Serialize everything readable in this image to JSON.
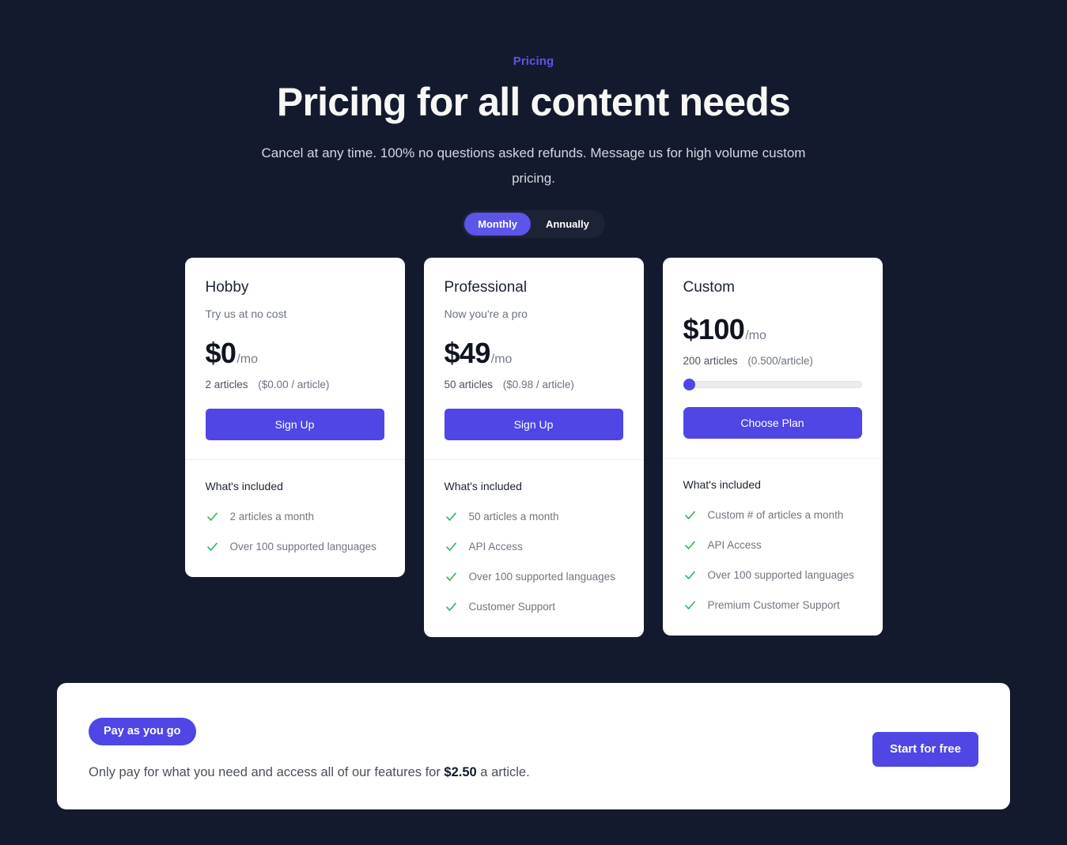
{
  "header": {
    "eyebrow": "Pricing",
    "headline": "Pricing for all content needs",
    "subhead": "Cancel at any time. 100% no questions asked refunds. Message us for high volume custom pricing."
  },
  "billing_toggle": {
    "monthly_label": "Monthly",
    "annually_label": "Annually",
    "selected": "Monthly"
  },
  "plans": [
    {
      "name": "Hobby",
      "tagline": "Try us at no cost",
      "price": "$0",
      "period": "/mo",
      "quota": "2 articles",
      "rate": "($0.00 / article)",
      "cta_label": "Sign Up",
      "included_title": "What's included",
      "features": [
        "2 articles a month",
        "Over 100 supported languages"
      ]
    },
    {
      "name": "Professional",
      "tagline": "Now you're a pro",
      "price": "$49",
      "period": "/mo",
      "quota": "50 articles",
      "rate": "($0.98 / article)",
      "cta_label": "Sign Up",
      "included_title": "What's included",
      "features": [
        "50 articles a month",
        "API Access",
        "Over 100 supported languages",
        "Customer Support"
      ]
    },
    {
      "name": "Custom",
      "tagline": "",
      "price": "$100",
      "period": "/mo",
      "quota": "200 articles",
      "rate": "(0.500/article)",
      "cta_label": "Choose Plan",
      "included_title": "What's included",
      "slider_value": 0,
      "features": [
        "Custom # of articles a month",
        "API Access",
        "Over 100 supported languages",
        "Premium Customer Support"
      ]
    }
  ],
  "banner": {
    "badge": "Pay as you go",
    "text_before": "Only pay for what you need and access all of our features for ",
    "price": "$2.50",
    "text_after": " a article.",
    "cta_label": "Start for free"
  },
  "colors": {
    "page_background": "#141a2e",
    "accent": "#4f46e5",
    "eyebrow": "#5b55ea",
    "check": "#3ab569"
  }
}
